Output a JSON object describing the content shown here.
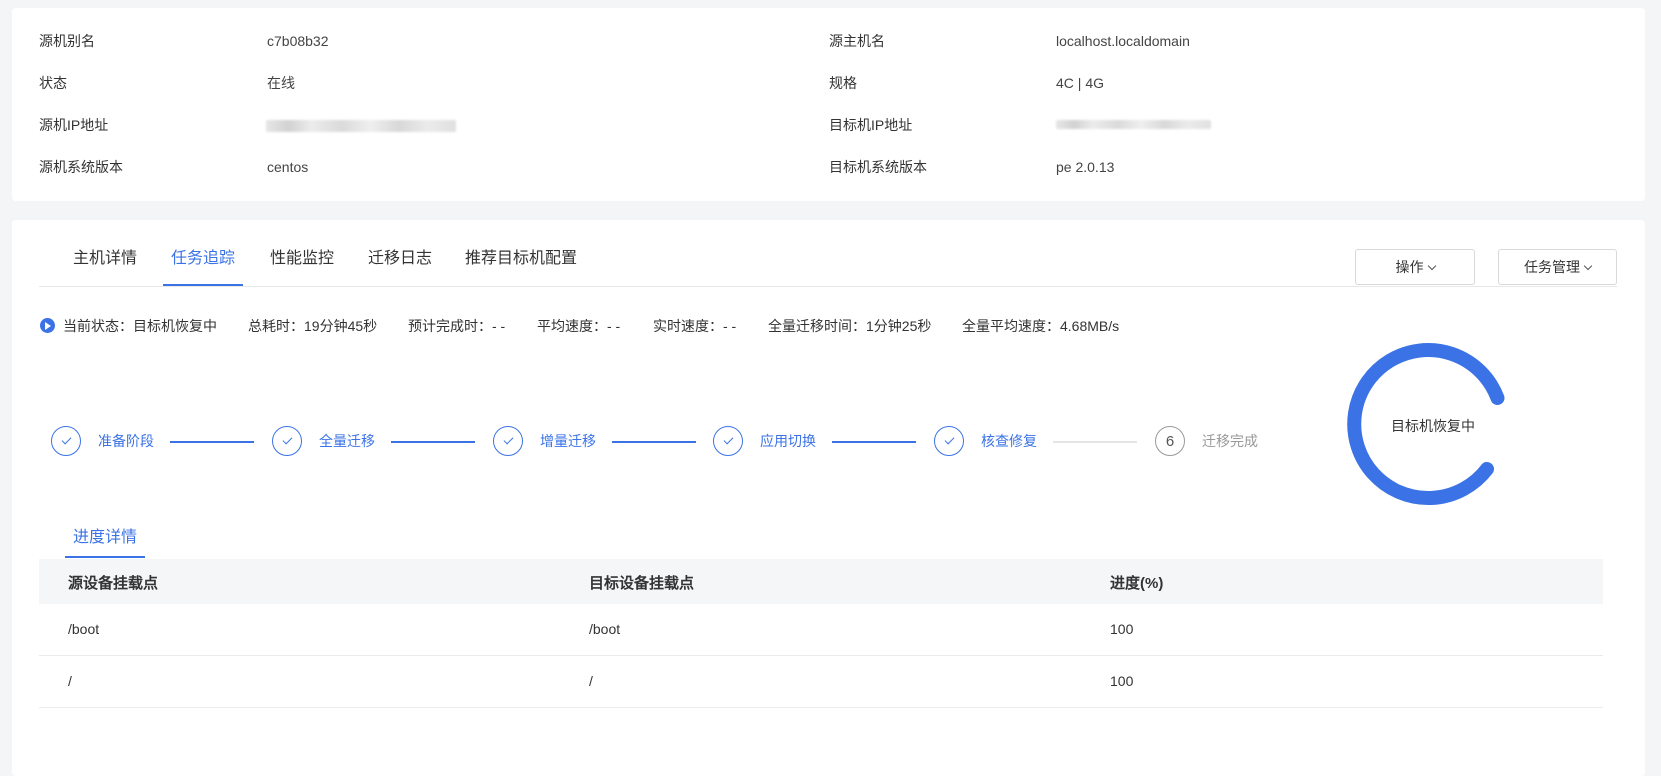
{
  "host_info": {
    "rows": [
      {
        "left_label": "源机别名",
        "left_value": "c7b08b32",
        "right_label": "源主机名",
        "right_value": "localhost.localdomain"
      },
      {
        "left_label": "状态",
        "left_value": "在线",
        "right_label": "规格",
        "right_value": "4C | 4G"
      },
      {
        "left_label": "源机IP地址",
        "left_value": "",
        "right_label": "目标机IP地址",
        "right_value": ""
      },
      {
        "left_label": "源机系统版本",
        "left_value": "centos",
        "right_label": "目标机系统版本",
        "right_value": "pe 2.0.13"
      }
    ]
  },
  "tabs": [
    {
      "label": "主机详情",
      "active": false
    },
    {
      "label": "任务追踪",
      "active": true
    },
    {
      "label": "性能监控",
      "active": false
    },
    {
      "label": "迁移日志",
      "active": false
    },
    {
      "label": "推荐目标机配置",
      "active": false
    }
  ],
  "actions": {
    "operate_label": "操作",
    "task_manage_label": "任务管理"
  },
  "status_bar": {
    "current_state": "当前状态：目标机恢复中",
    "total_time": "总耗时：19分钟45秒",
    "eta": "预计完成时：- -",
    "avg_speed": "平均速度：- -",
    "realtime_speed": "实时速度：- -",
    "full_migration_time": "全量迁移时间：1分钟25秒",
    "full_avg_speed": "全量平均速度：4.68MB/s"
  },
  "steps": [
    {
      "label": "准备阶段",
      "done": true
    },
    {
      "label": "全量迁移",
      "done": true
    },
    {
      "label": "增量迁移",
      "done": true
    },
    {
      "label": "应用切换",
      "done": true
    },
    {
      "label": "核查修复",
      "done": true
    },
    {
      "label": "迁移完成",
      "done": false,
      "number": "6"
    }
  ],
  "progress_ring": {
    "label": "目标机恢复中",
    "color": "#3b73e6"
  },
  "progress_detail": {
    "tab_label": "进度详情",
    "columns": [
      "源设备挂载点",
      "目标设备挂载点",
      "进度(%)"
    ],
    "rows": [
      [
        "/boot",
        "/boot",
        "100"
      ],
      [
        "/",
        "/",
        "100"
      ]
    ]
  },
  "colors": {
    "accent": "#3b73e6",
    "background": "#f4f5f7"
  }
}
